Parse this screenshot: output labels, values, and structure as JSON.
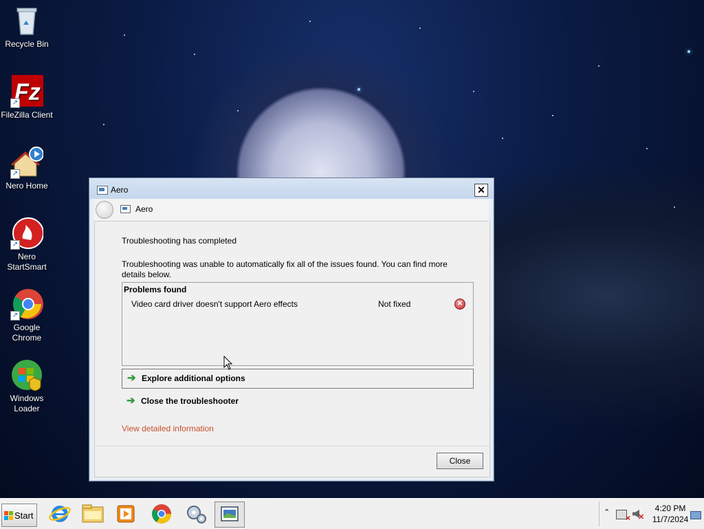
{
  "desktop": {
    "icons": [
      {
        "label": "Recycle Bin",
        "icon": "recycle-bin-icon"
      },
      {
        "label": "FileZilla Client",
        "icon": "filezilla-icon"
      },
      {
        "label": "Nero Home",
        "icon": "nero-home-icon"
      },
      {
        "label": "Nero StartSmart",
        "icon": "nero-startsmart-icon"
      },
      {
        "label": "Google Chrome",
        "icon": "chrome-icon"
      },
      {
        "label": "Windows Loader",
        "icon": "windows-loader-icon"
      }
    ]
  },
  "window": {
    "title": "Aero",
    "nav_title": "Aero",
    "status_heading": "Troubleshooting has completed",
    "status_description": "Troubleshooting was unable to automatically fix all of the issues found. You can find more details below.",
    "problems": {
      "heading": "Problems found",
      "rows": [
        {
          "name": "Video card driver doesn't support Aero effects",
          "status": "Not fixed",
          "icon": "error-icon"
        }
      ]
    },
    "options": [
      {
        "label": "Explore additional options"
      },
      {
        "label": "Close the troubleshooter"
      }
    ],
    "detail_link": "View detailed information",
    "close_button": "Close"
  },
  "taskbar": {
    "start_label": "Start",
    "pinned": [
      "internet-explorer-icon",
      "file-explorer-icon",
      "media-player-icon",
      "chrome-icon",
      "troubleshooter-icon",
      "aero-window-icon"
    ],
    "clock_time": "4:20 PM",
    "clock_date": "11/7/2024"
  },
  "colors": {
    "accent_green": "#2e9a3a",
    "link": "#c8502a",
    "error": "#c0282b",
    "titlebar": "#c5d7ed"
  }
}
